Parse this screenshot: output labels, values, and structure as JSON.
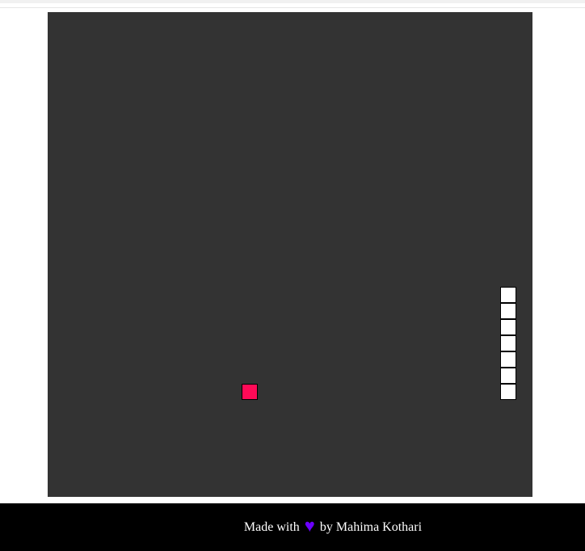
{
  "game": {
    "board_color": "#333333",
    "snake_color": "#ffffff",
    "food_color": "#ff0a57",
    "grid": {
      "cols": 30,
      "rows": 30
    },
    "snake": [
      {
        "col": 28,
        "row": 17
      },
      {
        "col": 28,
        "row": 18
      },
      {
        "col": 28,
        "row": 19
      },
      {
        "col": 28,
        "row": 20
      },
      {
        "col": 28,
        "row": 21
      },
      {
        "col": 28,
        "row": 22
      },
      {
        "col": 28,
        "row": 23
      }
    ],
    "food": {
      "col": 12,
      "row": 23
    }
  },
  "footer": {
    "made_with": "Made with",
    "heart_icon": "♥",
    "heart_color": "#6b00ff",
    "by_author": "by Mahima Kothari"
  }
}
